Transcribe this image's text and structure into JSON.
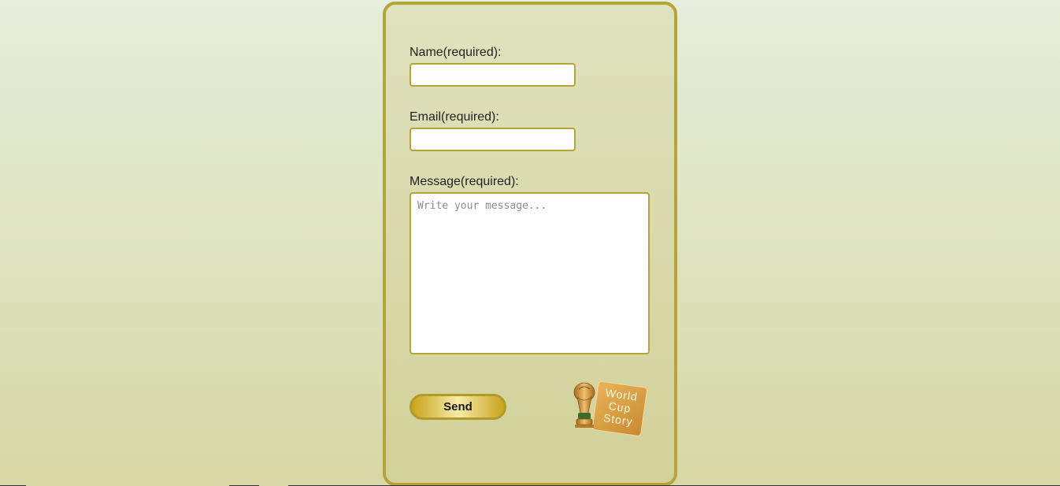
{
  "form": {
    "name_label": "Name(required):",
    "name_value": "",
    "email_label": "Email(required):",
    "email_value": "",
    "message_label": "Message(required):",
    "message_value": "",
    "message_placeholder": "Write your message...",
    "send_label": "Send"
  },
  "logo": {
    "line1": "World",
    "line2": "Cup",
    "line3": "Story"
  },
  "colors": {
    "border_gold": "#b5a43a",
    "background_top": "#e6eedc",
    "background_bottom": "#d7d8a5"
  }
}
